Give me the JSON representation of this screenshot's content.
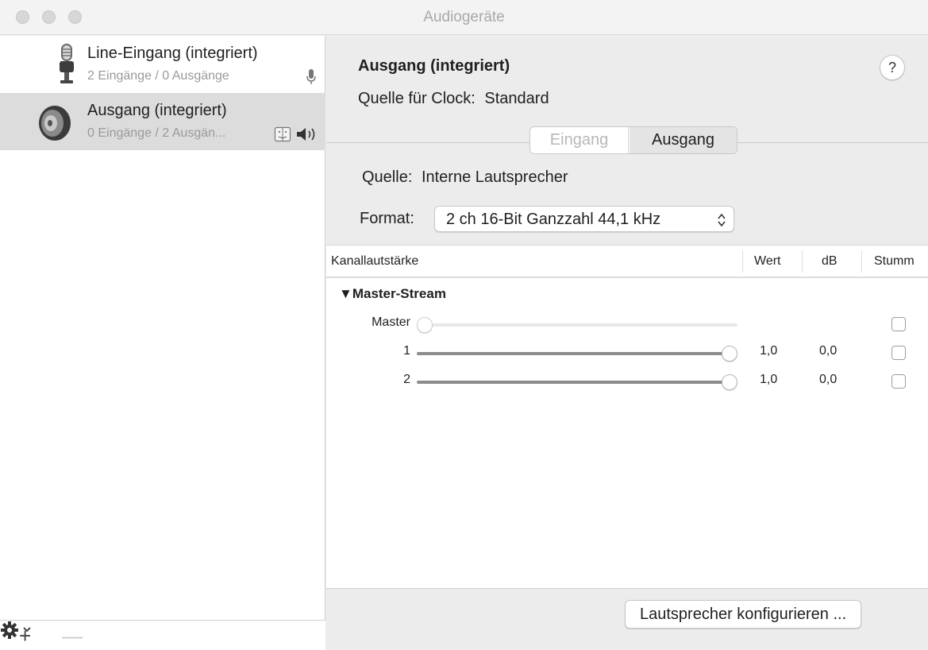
{
  "window": {
    "title": "Audiogeräte"
  },
  "sidebar": {
    "devices": [
      {
        "name": "Line-Eingang (integriert)",
        "detail": "2 Eingänge / 0 Ausgänge",
        "icon": "microphone-icon",
        "badges": [
          "microphone-icon"
        ],
        "selected": false
      },
      {
        "name": "Ausgang (integriert)",
        "detail": "0 Eingänge / 2 Ausgän...",
        "icon": "speaker-icon",
        "badges": [
          "finder-icon",
          "speaker-volume-icon"
        ],
        "selected": true
      }
    ],
    "footer": {
      "add_label": "+",
      "remove_label": "—",
      "gear_icon": "gear-icon"
    }
  },
  "detail": {
    "device_title": "Ausgang (integriert)",
    "clock_label": "Quelle für Clock:",
    "clock_value": "Standard",
    "help_label": "?",
    "tabs": [
      {
        "label": "Eingang",
        "active": false
      },
      {
        "label": "Ausgang",
        "active": true
      }
    ],
    "source_label": "Quelle:",
    "source_value": "Interne Lautsprecher",
    "format_label": "Format:",
    "format_value": "2 ch 16-Bit Ganzzahl 44,1 kHz",
    "table": {
      "headers": [
        "Kanallautstärke",
        "Wert",
        "dB",
        "Stumm"
      ],
      "group": "▼Master-Stream",
      "rows": [
        {
          "label": "Master",
          "level": 0.0,
          "enabled": false,
          "wert": "",
          "db": "",
          "muted": false
        },
        {
          "label": "1",
          "level": 1.0,
          "enabled": true,
          "wert": "1,0",
          "db": "0,0",
          "muted": false
        },
        {
          "label": "2",
          "level": 1.0,
          "enabled": true,
          "wert": "1,0",
          "db": "0,0",
          "muted": false
        }
      ]
    },
    "configure_button": "Lautsprecher konfigurieren ..."
  },
  "colors": {
    "selection": "#dcdcdc",
    "slider_fill": "#8c8c8c",
    "slider_disabled": "#e6e6e6",
    "muted_text": "#9a9a9a"
  }
}
